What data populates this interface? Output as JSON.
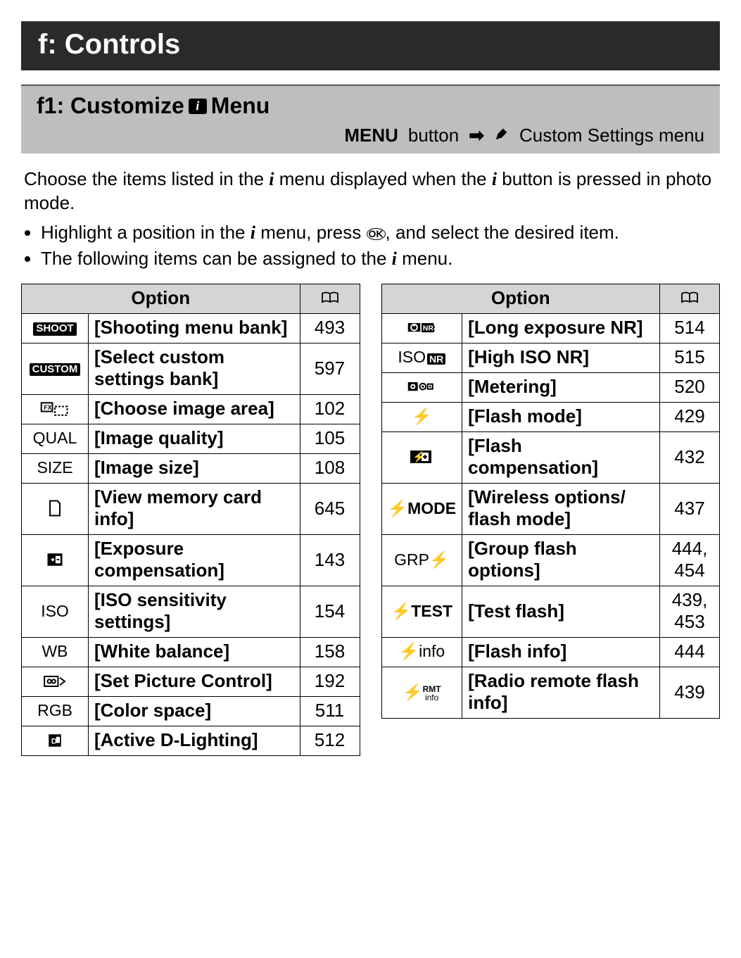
{
  "section_title": "f: Controls",
  "sub_title_pre": "f1: Customize ",
  "sub_title_post": " Menu",
  "sub_path_menu": "MENU",
  "sub_path_button": "button",
  "sub_path_dest": "Custom Settings menu",
  "intro_1a": "Choose the items listed in the ",
  "intro_1b": " menu displayed when the ",
  "intro_1c": " button is pressed in photo mode.",
  "bullet1a": "Highlight a position in the ",
  "bullet1b": " menu, press ",
  "bullet1c": ", and select the desired item.",
  "bullet2a": "The following items can be assigned to the ",
  "bullet2b": " menu.",
  "th_option": "Option",
  "left": [
    {
      "icon": "shoot",
      "name": "[Shooting menu bank]",
      "page": "493"
    },
    {
      "icon": "custom",
      "name": "[Select custom settings bank]",
      "page": "597"
    },
    {
      "icon": "fx",
      "name": "[Choose image area]",
      "page": "102"
    },
    {
      "icon": "qual",
      "name": "[Image quality]",
      "page": "105"
    },
    {
      "icon": "size",
      "name": "[Image size]",
      "page": "108"
    },
    {
      "icon": "card",
      "name": "[View memory card info]",
      "page": "645"
    },
    {
      "icon": "expcomp",
      "name": "[Exposure compensation]",
      "page": "143"
    },
    {
      "icon": "iso",
      "name": "[ISO sensitivity settings]",
      "page": "154"
    },
    {
      "icon": "wb",
      "name": "[White balance]",
      "page": "158"
    },
    {
      "icon": "pc",
      "name": "[Set Picture Control]",
      "page": "192"
    },
    {
      "icon": "rgb",
      "name": "[Color space]",
      "page": "511"
    },
    {
      "icon": "adl",
      "name": "[Active D-Lighting]",
      "page": "512"
    }
  ],
  "right": [
    {
      "icon": "lenr",
      "name": "[Long exposure NR]",
      "page": "514"
    },
    {
      "icon": "isonr",
      "name": "[High ISO NR]",
      "page": "515"
    },
    {
      "icon": "meter",
      "name": "[Metering]",
      "page": "520"
    },
    {
      "icon": "flashmode",
      "name": "[Flash mode]",
      "page": "429"
    },
    {
      "icon": "flashcomp",
      "name": "[Flash compensation]",
      "page": "432"
    },
    {
      "icon": "flashmode2",
      "name": "[Wireless options/ flash mode]",
      "page": "437"
    },
    {
      "icon": "grp",
      "name": "[Group flash options]",
      "page": "444, 454"
    },
    {
      "icon": "test",
      "name": "[Test flash]",
      "page": "439, 453"
    },
    {
      "icon": "finfo",
      "name": "[Flash info]",
      "page": "444"
    },
    {
      "icon": "frmt",
      "name": "[Radio remote flash info]",
      "page": "439"
    }
  ]
}
